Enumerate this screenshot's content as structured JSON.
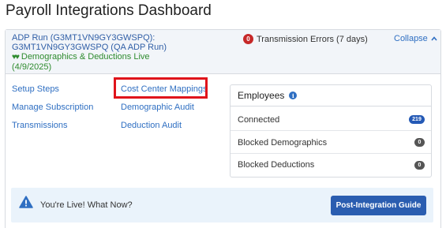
{
  "page": {
    "title": "Payroll Integrations Dashboard"
  },
  "integration": {
    "name": "ADP Run (G3MT1VN9GY3GWSPQ): G3MT1VN9GY3GWSPQ (QA ADP Run)",
    "status_label": "Demographics & Deductions Live",
    "status_date": "(4/9/2025)",
    "errors_count": "0",
    "errors_label": "Transmission Errors (7 days)",
    "collapse_label": "Collapse",
    "status_color": "#2e8b2e"
  },
  "links": {
    "setup_steps": "Setup Steps",
    "manage_subscription": "Manage Subscription",
    "transmissions": "Transmissions",
    "cost_center_mappings": "Cost Center Mappings",
    "demographic_audit": "Demographic Audit",
    "deduction_audit": "Deduction Audit"
  },
  "employees": {
    "title": "Employees",
    "rows": [
      {
        "label": "Connected",
        "count": "219"
      },
      {
        "label": "Blocked Demographics",
        "count": "0"
      },
      {
        "label": "Blocked Deductions",
        "count": "0"
      }
    ]
  },
  "banner": {
    "message": "You're Live! What Now?",
    "button_label": "Post-Integration Guide"
  },
  "colors": {
    "accent": "#2f6fc2",
    "button": "#2a5db0",
    "highlight": "#e0141b",
    "error_badge": "#c62828"
  },
  "icons": {
    "leaf": "leaf-icon",
    "error": "error-count-badge",
    "collapse": "chevron-up-icon",
    "info": "info-icon",
    "warning": "warning-icon"
  }
}
